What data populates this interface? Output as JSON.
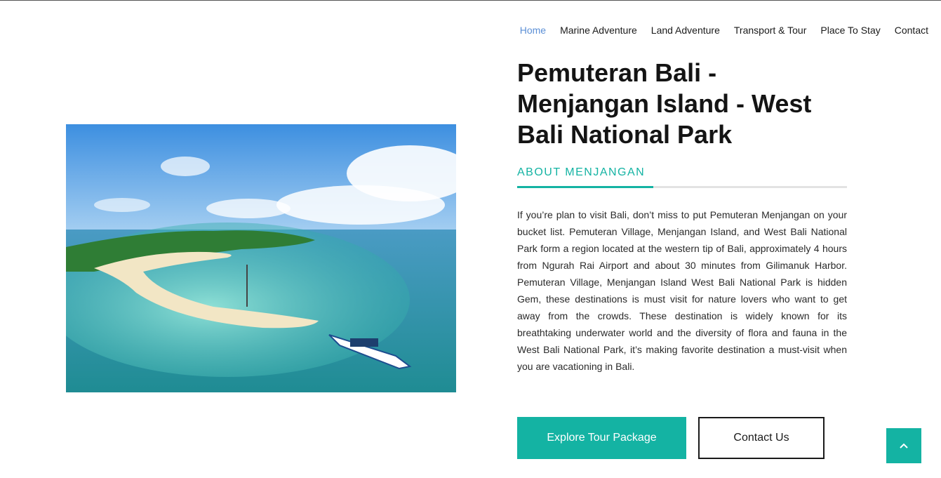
{
  "nav": {
    "items": [
      {
        "label": "Home",
        "active": true
      },
      {
        "label": "Marine Adventure",
        "active": false
      },
      {
        "label": "Land Adventure",
        "active": false
      },
      {
        "label": "Transport & Tour",
        "active": false
      },
      {
        "label": "Place To Stay",
        "active": false
      },
      {
        "label": "Contact",
        "active": false
      }
    ]
  },
  "hero": {
    "image_icon": "island-photo",
    "title": "Pemuteran Bali - Menjangan Island - West Bali National Park",
    "section_label": "ABOUT MENJANGAN",
    "description": "If you’re plan to visit Bali, don’t miss to put Pemuteran Menjangan on your bucket list. Pemuteran Village, Menjangan Island, and West Bali National Park form a region located at the western tip of Bali, approximately 4 hours from Ngurah Rai Airport and about 30 minutes from Gilimanuk Harbor. Pemuteran Village, Menjangan Island West Bali National Park is hidden Gem, these destinations is must visit for nature lovers who want to get away from the crowds. These destination is widely known for its breathtaking underwater world and the diversity of flora and fauna in the West Bali National Park, it’s making favorite destination a must-visit when you are vacationing in Bali."
  },
  "buttons": {
    "primary_label": "Explore Tour Package",
    "secondary_label": "Contact Us"
  },
  "scroll_top": {
    "icon": "chevron-up-icon"
  },
  "colors": {
    "accent": "#14b3a3",
    "nav_active": "#5b8fd6",
    "text": "#1a1a1a"
  }
}
